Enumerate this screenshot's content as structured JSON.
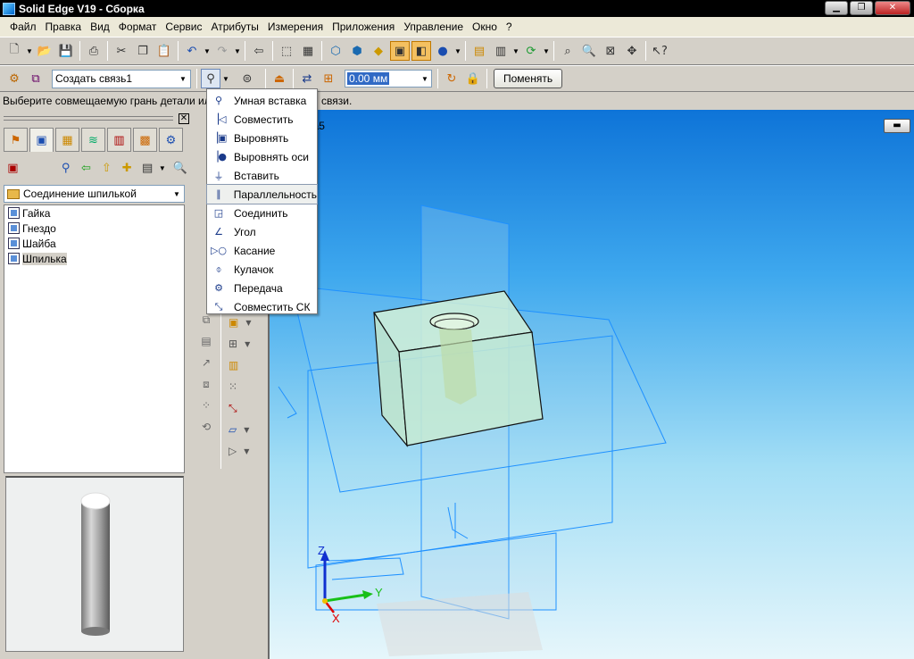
{
  "window": {
    "title": "Solid Edge V19 - Сборка"
  },
  "window_buttons": {
    "minimize": "▁",
    "maximize": "❐",
    "close": "✕"
  },
  "menubar": [
    "Файл",
    "Правка",
    "Вид",
    "Формат",
    "Сервис",
    "Атрибуты",
    "Измерения",
    "Приложения",
    "Управление",
    "Окно",
    "?"
  ],
  "toolbar2": {
    "relation_combo": "Создать связь1",
    "offset_value": "0.00 мм",
    "apply_button": "Поменять"
  },
  "prompt": {
    "left": "Выберите совмещаемую грань детали ил",
    "right": "связи."
  },
  "left_panel": {
    "close": "✕",
    "combo": "Соединение шпилькой",
    "tree": [
      {
        "label": "Гайка"
      },
      {
        "label": "Гнездо"
      },
      {
        "label": "Шайба"
      },
      {
        "label": "Шпилька",
        "selected": true
      }
    ]
  },
  "viewport": {
    "title_fragment": "ка5",
    "axes": {
      "x": "X",
      "y": "Y",
      "z": "Z"
    },
    "colors": {
      "grid_lines": "#1e90ff",
      "axis_x": "#e00000",
      "axis_y": "#18c018",
      "axis_z": "#1030d0"
    }
  },
  "dropdown_menu": {
    "items": [
      {
        "label": "Умная вставка",
        "icon": "smart-insert-icon"
      },
      {
        "label": "Совместить",
        "icon": "mate-icon"
      },
      {
        "label": "Выровнять",
        "icon": "align-icon"
      },
      {
        "label": "Выровнять оси",
        "icon": "axial-align-icon"
      },
      {
        "label": "Вставить",
        "icon": "insert-icon"
      },
      {
        "label": "Параллельность",
        "icon": "parallel-icon",
        "highlighted": true
      },
      {
        "label": "Соединить",
        "icon": "connect-icon"
      },
      {
        "label": "Угол",
        "icon": "angle-icon"
      },
      {
        "label": "Касание",
        "icon": "tangent-icon"
      },
      {
        "label": "Кулачок",
        "icon": "cam-icon"
      },
      {
        "label": "Передача",
        "icon": "gear-icon"
      },
      {
        "label": "Совместить СК",
        "icon": "match-cs-icon"
      }
    ]
  }
}
